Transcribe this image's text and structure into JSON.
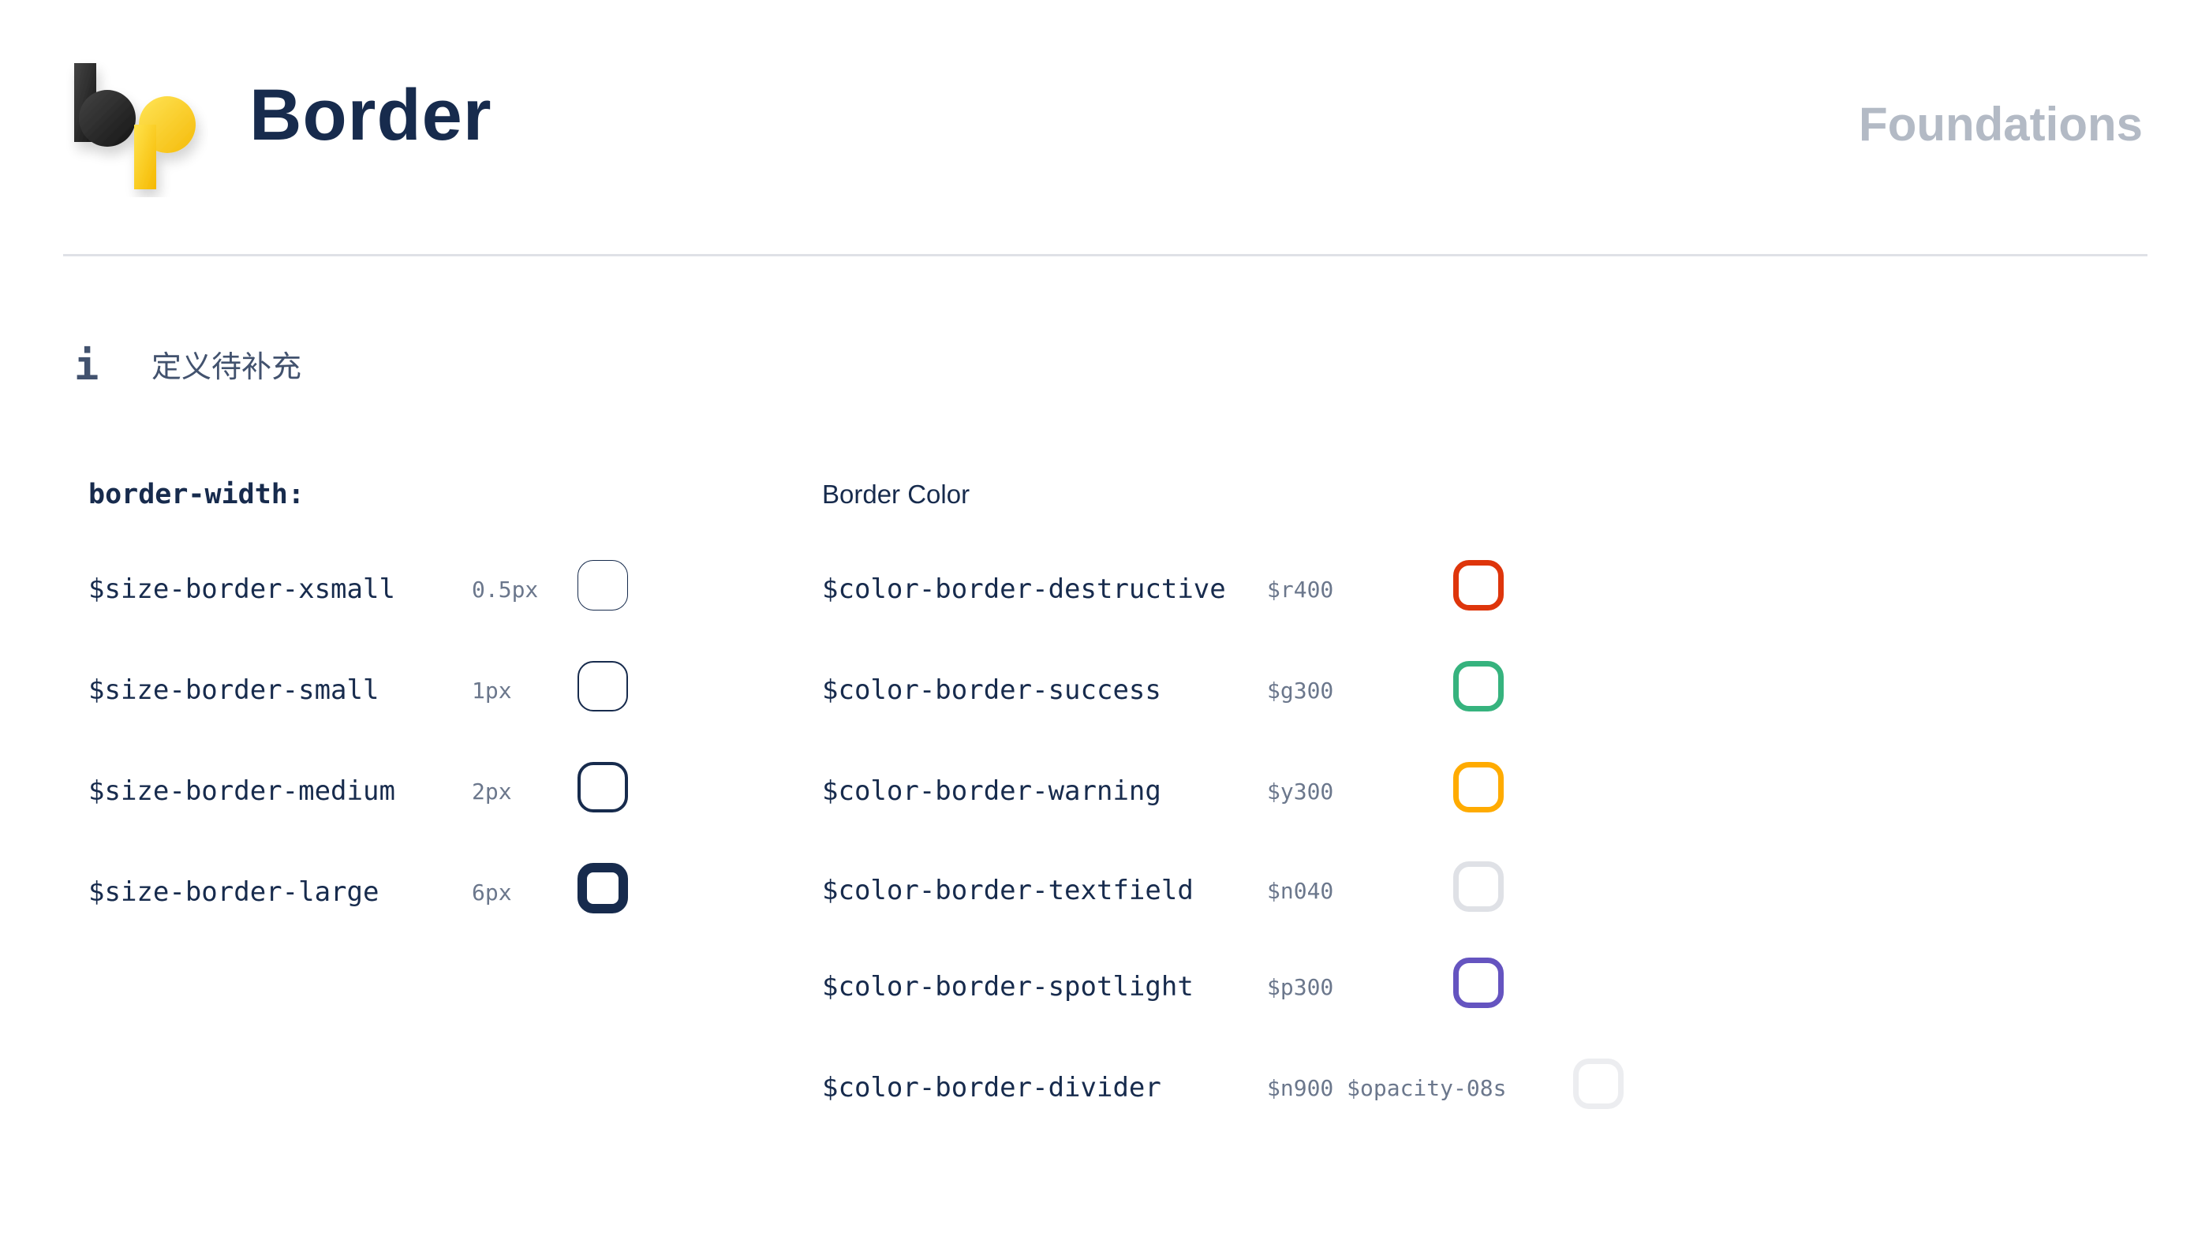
{
  "header": {
    "title": "Border",
    "section": "Foundations",
    "logo_text": "bp"
  },
  "info": {
    "icon": "info-icon",
    "icon_glyph": "i",
    "text": "定义待补充"
  },
  "border_width": {
    "heading": "border-width:",
    "rows": [
      {
        "token": "$size-border-xsmall",
        "value": "0.5px"
      },
      {
        "token": "$size-border-small",
        "value": "1px"
      },
      {
        "token": "$size-border-medium",
        "value": "2px"
      },
      {
        "token": "$size-border-large",
        "value": "6px"
      }
    ]
  },
  "border_color": {
    "heading": "Border Color",
    "rows": [
      {
        "token": "$color-border-destructive",
        "value": "$r400",
        "color": "#de350b"
      },
      {
        "token": "$color-border-success",
        "value": "$g300",
        "color": "#36b37e"
      },
      {
        "token": "$color-border-warning",
        "value": "$y300",
        "color": "#ffab00"
      },
      {
        "token": "$color-border-textfield",
        "value": "$n040",
        "color": "#dfe1e6"
      },
      {
        "token": "$color-border-spotlight",
        "value": "$p300",
        "color": "#6554c0"
      },
      {
        "token": "$color-border-divider",
        "value": "$n900 $opacity-08s",
        "color": "#091e42",
        "opacity": 0.08
      }
    ]
  },
  "colors": {
    "title": "#172b4d",
    "section_label": "#b3bac5",
    "divider": "#dfe1e6",
    "muted_text": "#6b778c",
    "logo_dark": "#2b2b2b",
    "logo_yellow": "#ffd200"
  }
}
